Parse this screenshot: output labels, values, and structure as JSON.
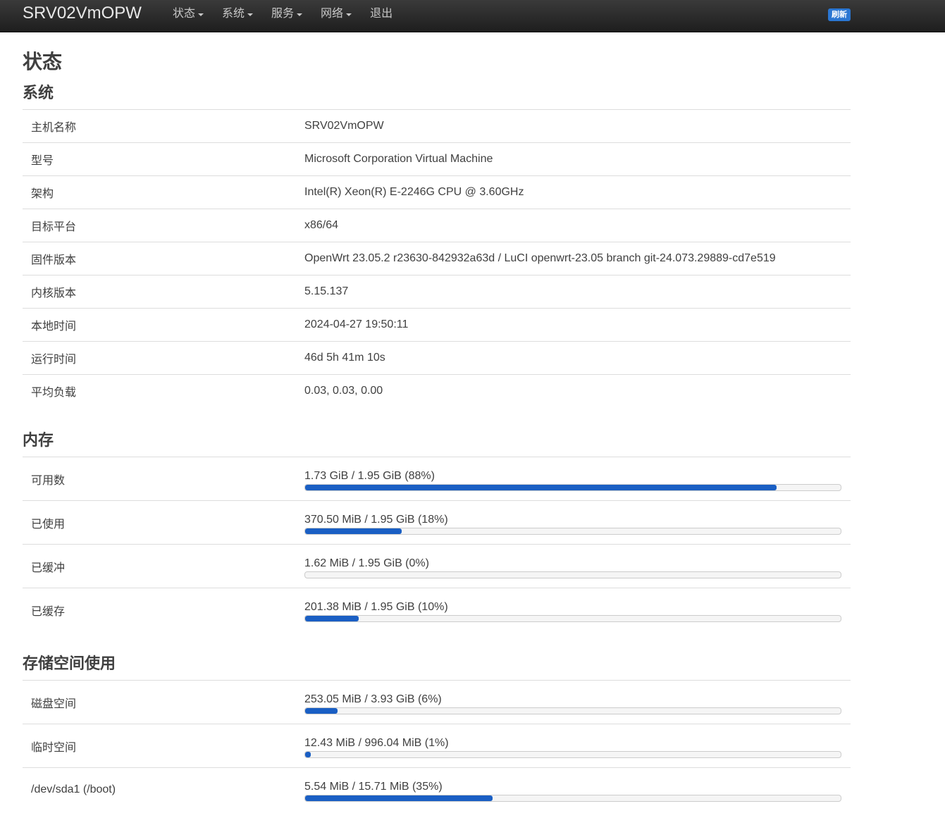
{
  "header": {
    "brand": "SRV02VmOPW",
    "menu": [
      {
        "label": "状态",
        "dropdown": true
      },
      {
        "label": "系统",
        "dropdown": true
      },
      {
        "label": "服务",
        "dropdown": true
      },
      {
        "label": "网络",
        "dropdown": true
      },
      {
        "label": "退出",
        "dropdown": false
      }
    ],
    "refresh_label": "刷新"
  },
  "page_title": "状态",
  "system": {
    "title": "系统",
    "rows": [
      {
        "label": "主机名称",
        "value": "SRV02VmOPW"
      },
      {
        "label": "型号",
        "value": "Microsoft Corporation Virtual Machine"
      },
      {
        "label": "架构",
        "value": "Intel(R) Xeon(R) E-2246G CPU @ 3.60GHz"
      },
      {
        "label": "目标平台",
        "value": "x86/64"
      },
      {
        "label": "固件版本",
        "value": "OpenWrt 23.05.2 r23630-842932a63d / LuCI openwrt-23.05 branch git-24.073.29889-cd7e519"
      },
      {
        "label": "内核版本",
        "value": "5.15.137"
      },
      {
        "label": "本地时间",
        "value": "2024-04-27 19:50:11"
      },
      {
        "label": "运行时间",
        "value": "46d 5h 41m 10s"
      },
      {
        "label": "平均负载",
        "value": "0.03, 0.03, 0.00"
      }
    ]
  },
  "memory": {
    "title": "内存",
    "rows": [
      {
        "label": "可用数",
        "text": "1.73 GiB / 1.95 GiB (88%)",
        "fraction": 0.88
      },
      {
        "label": "已使用",
        "text": "370.50 MiB / 1.95 GiB (18%)",
        "fraction": 0.18
      },
      {
        "label": "已缓冲",
        "text": "1.62 MiB / 1.95 GiB (0%)",
        "fraction": 0.0
      },
      {
        "label": "已缓存",
        "text": "201.38 MiB / 1.95 GiB (10%)",
        "fraction": 0.1
      }
    ]
  },
  "storage": {
    "title": "存储空间使用",
    "rows": [
      {
        "label": "磁盘空间",
        "text": "253.05 MiB / 3.93 GiB (6%)",
        "fraction": 0.06
      },
      {
        "label": "临时空间",
        "text": "12.43 MiB / 996.04 MiB (1%)",
        "fraction": 0.01
      },
      {
        "label": "/dev/sda1 (/boot)",
        "text": "5.54 MiB / 15.71 MiB (35%)",
        "fraction": 0.35
      }
    ]
  },
  "colors": {
    "navbar": "#2a2a2a",
    "accent": "#1a5fc4",
    "refresh_badge": "#2a76d2"
  }
}
